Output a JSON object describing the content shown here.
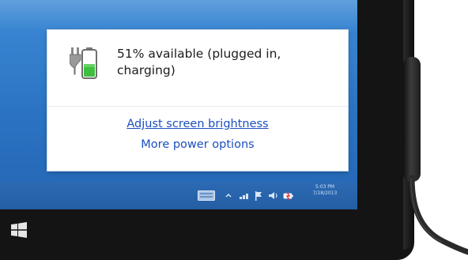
{
  "flyout": {
    "status_line1": "51% available (plugged in,",
    "status_line2": "charging)",
    "battery_level": 0.51,
    "links": {
      "brightness": "Adjust screen brightness",
      "power_options": "More power options"
    }
  },
  "taskbar": {
    "clock_time": "5:03 PM",
    "clock_date": "7/18/2013",
    "tray_icons": [
      "keyboard-icon",
      "chevron-up-icon",
      "network-icon",
      "flag-icon",
      "volume-icon",
      "power-icon"
    ]
  },
  "colors": {
    "desktop": "#2b73c2",
    "link": "#1a4fbf",
    "battery_fill": "#3fbf3f"
  },
  "start_button": {
    "icon": "windows-logo-icon"
  }
}
